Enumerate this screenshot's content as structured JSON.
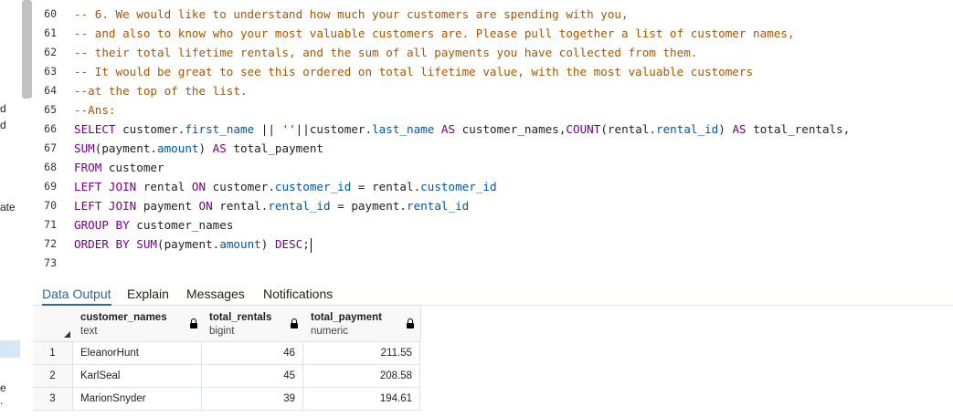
{
  "left_panel": {
    "fragments": [
      "d",
      "d",
      "ate",
      "e",
      "."
    ]
  },
  "editor": {
    "lines": [
      {
        "num": "60",
        "tokens": [
          {
            "t": "-- 6. We would like to understand how much your customers are spending with you,",
            "c": "cm"
          }
        ]
      },
      {
        "num": "61",
        "tokens": [
          {
            "t": "-- and also to know who your most valuable customers are. Please pull together a list of customer names,",
            "c": "cm"
          }
        ]
      },
      {
        "num": "62",
        "tokens": [
          {
            "t": "-- their total lifetime rentals, and the sum of all payments you have collected from them.",
            "c": "cm"
          }
        ]
      },
      {
        "num": "63",
        "tokens": [
          {
            "t": "-- It would be great to see this ordered on total lifetime value, with the most valuable customers",
            "c": "cm"
          }
        ]
      },
      {
        "num": "64",
        "tokens": [
          {
            "t": "--at the top of the list.",
            "c": "cm"
          }
        ]
      },
      {
        "num": "65",
        "tokens": [
          {
            "t": "--Ans:",
            "c": "cm"
          }
        ]
      },
      {
        "num": "66",
        "tokens": [
          {
            "t": "SELECT",
            "c": "kw"
          },
          {
            "t": " customer.",
            "c": "pl"
          },
          {
            "t": "first_name",
            "c": "pr"
          },
          {
            "t": " || ",
            "c": "pl"
          },
          {
            "t": "''",
            "c": "st"
          },
          {
            "t": "||customer.",
            "c": "pl"
          },
          {
            "t": "last_name",
            "c": "pr"
          },
          {
            "t": " ",
            "c": "pl"
          },
          {
            "t": "AS",
            "c": "kw"
          },
          {
            "t": " customer_names,",
            "c": "pl"
          },
          {
            "t": "COUNT",
            "c": "fn"
          },
          {
            "t": "(rental.",
            "c": "pl"
          },
          {
            "t": "rental_id",
            "c": "pr"
          },
          {
            "t": ") ",
            "c": "pl"
          },
          {
            "t": "AS",
            "c": "kw"
          },
          {
            "t": " total_rentals,",
            "c": "pl"
          }
        ]
      },
      {
        "num": "67",
        "tokens": [
          {
            "t": "SUM",
            "c": "fn"
          },
          {
            "t": "(payment.",
            "c": "pl"
          },
          {
            "t": "amount",
            "c": "pr"
          },
          {
            "t": ") ",
            "c": "pl"
          },
          {
            "t": "AS",
            "c": "kw"
          },
          {
            "t": " total_payment",
            "c": "pl"
          }
        ]
      },
      {
        "num": "68",
        "tokens": [
          {
            "t": "FROM",
            "c": "kw"
          },
          {
            "t": " customer",
            "c": "pl"
          }
        ]
      },
      {
        "num": "69",
        "tokens": [
          {
            "t": "LEFT JOIN",
            "c": "kw"
          },
          {
            "t": " rental ",
            "c": "pl"
          },
          {
            "t": "ON",
            "c": "kw"
          },
          {
            "t": " customer.",
            "c": "pl"
          },
          {
            "t": "customer_id",
            "c": "pr"
          },
          {
            "t": " = rental.",
            "c": "pl"
          },
          {
            "t": "customer_id",
            "c": "pr"
          }
        ]
      },
      {
        "num": "70",
        "tokens": [
          {
            "t": "LEFT JOIN",
            "c": "kw"
          },
          {
            "t": " payment ",
            "c": "pl"
          },
          {
            "t": "ON",
            "c": "kw"
          },
          {
            "t": " rental.",
            "c": "pl"
          },
          {
            "t": "rental_id",
            "c": "pr"
          },
          {
            "t": " = payment.",
            "c": "pl"
          },
          {
            "t": "rental_id",
            "c": "pr"
          }
        ]
      },
      {
        "num": "71",
        "tokens": [
          {
            "t": "GROUP BY",
            "c": "kw"
          },
          {
            "t": " customer_names",
            "c": "pl"
          }
        ]
      },
      {
        "num": "72",
        "tokens": [
          {
            "t": "ORDER BY",
            "c": "kw"
          },
          {
            "t": " ",
            "c": "pl"
          },
          {
            "t": "SUM",
            "c": "fn"
          },
          {
            "t": "(payment.",
            "c": "pl"
          },
          {
            "t": "amount",
            "c": "pr"
          },
          {
            "t": ") ",
            "c": "pl"
          },
          {
            "t": "DESC",
            "c": "kw"
          },
          {
            "t": ";",
            "c": "pl"
          }
        ]
      },
      {
        "num": "73",
        "tokens": []
      }
    ]
  },
  "tabs": [
    {
      "label": "Data Output",
      "active": true
    },
    {
      "label": "Explain",
      "active": false
    },
    {
      "label": "Messages",
      "active": false
    },
    {
      "label": "Notifications",
      "active": false
    }
  ],
  "grid": {
    "columns": [
      {
        "name": "customer_names",
        "type": "text"
      },
      {
        "name": "total_rentals",
        "type": "bigint"
      },
      {
        "name": "total_payment",
        "type": "numeric"
      }
    ],
    "rows": [
      {
        "index": "1",
        "values": [
          "EleanorHunt",
          "46",
          "211.55"
        ]
      },
      {
        "index": "2",
        "values": [
          "KarlSeal",
          "45",
          "208.58"
        ]
      },
      {
        "index": "3",
        "values": [
          "MarionSnyder",
          "39",
          "194.61"
        ]
      }
    ]
  },
  "colors": {
    "comment": "#aa5500",
    "keyword": "#770088",
    "property": "#0055aa",
    "string": "#aa1111",
    "tab_active": "#326690"
  }
}
